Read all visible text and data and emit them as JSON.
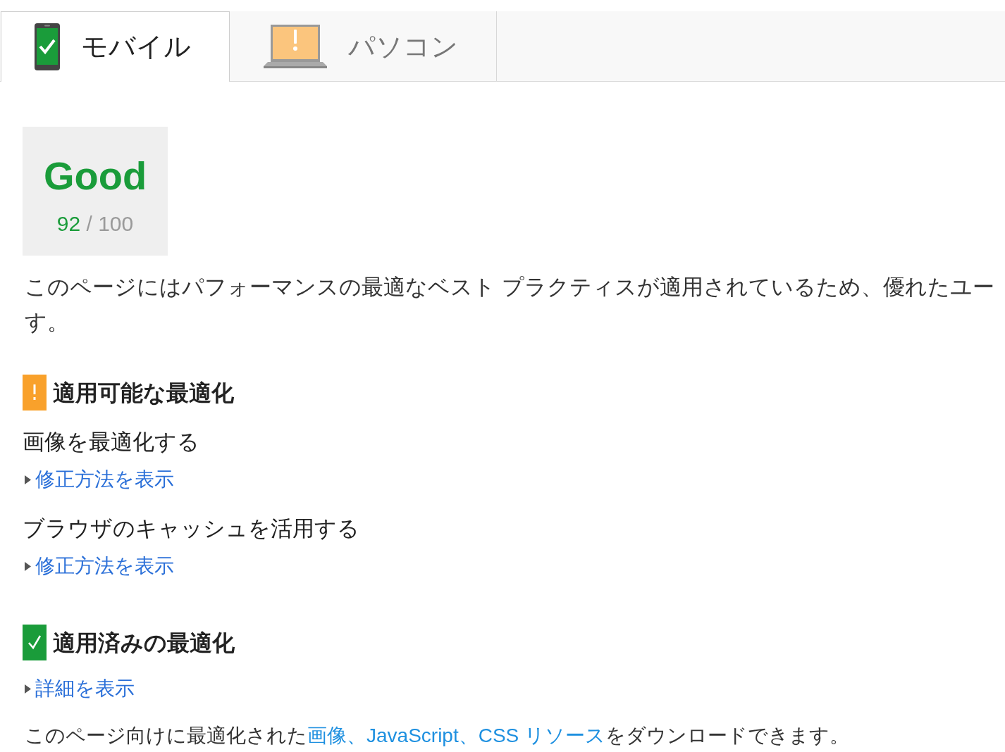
{
  "tabs": [
    {
      "label": "モバイル",
      "kind": "mobile",
      "passed": true,
      "selected": true
    },
    {
      "label": "パソコン",
      "kind": "desktop",
      "passed": false,
      "selected": false
    }
  ],
  "score": {
    "rating": "Good",
    "value": "92",
    "out_of": "/ 100"
  },
  "summary": {
    "lines": [
      "このページにはパフォーマンスの最適なベスト プラクティスが適用されているため、優れたユー",
      "す。"
    ]
  },
  "sections": [
    {
      "kind": "warning",
      "title": "適用可能な最適化",
      "rules": [
        {
          "title": "画像を最適化する",
          "toggle": {
            "label": "修正方法を表示",
            "expanded": false
          }
        },
        {
          "title": "ブラウザのキャッシュを活用する",
          "toggle": {
            "label": "修正方法を表示",
            "expanded": false
          }
        }
      ]
    },
    {
      "kind": "passed",
      "title": "適用済みの最適化",
      "toggle": {
        "label": "詳細を表示",
        "expanded": false
      },
      "note": {
        "before": "このページ向けに最適化された",
        "link": "画像、JavaScript、CSS リソース",
        "after": "をダウンロードできます。"
      }
    }
  ]
}
